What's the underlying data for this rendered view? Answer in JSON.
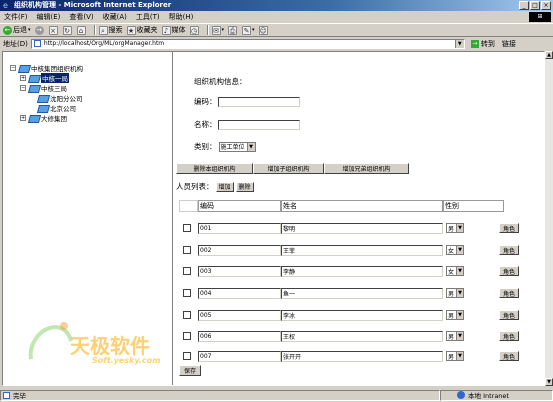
{
  "window": {
    "title": "组织机构管理 - Microsoft Internet Explorer",
    "controls": [
      "_",
      "□",
      "×"
    ]
  },
  "menu": [
    "文件(F)",
    "编辑(E)",
    "查看(V)",
    "收藏(A)",
    "工具(T)",
    "帮助(H)"
  ],
  "toolbar": {
    "back": "后退",
    "search": "搜索",
    "favorites": "收藏夹",
    "media": "媒体"
  },
  "address": {
    "label": "地址(D)",
    "url": "http://localhost/Org/ML/orgManager.htm",
    "go": "转到",
    "links": "链接"
  },
  "tree": {
    "root": "中核集团组织机构",
    "nodes": [
      {
        "label": "中核一局",
        "selected": true
      },
      {
        "label": "中核三局",
        "selected": false
      },
      {
        "label": "沈阳分公司",
        "selected": false
      },
      {
        "label": "北京公司",
        "selected": false
      },
      {
        "label": "大修集团",
        "selected": false
      }
    ]
  },
  "org_info": {
    "title": "组织机构信息：",
    "code_label": "编码：",
    "code_value": "",
    "name_label": "名称：",
    "name_value": "",
    "type_label": "类别：",
    "type_value": "施工单位"
  },
  "actions": {
    "delete_org": "删除本组织机构",
    "add_child": "增加子组织机构",
    "add_sibling": "增加兄弟组织机构"
  },
  "staff": {
    "title": "人员列表：",
    "add": "增加",
    "delete": "删除",
    "columns": [
      "编码",
      "姓名",
      "性别"
    ],
    "role_label": "角色",
    "rows": [
      {
        "code": "001",
        "name": "黎明",
        "gender": "男"
      },
      {
        "code": "002",
        "name": "王菲",
        "gender": "女"
      },
      {
        "code": "003",
        "name": "李静",
        "gender": "女"
      },
      {
        "code": "004",
        "name": "鱼一",
        "gender": "男"
      },
      {
        "code": "005",
        "name": "李冰",
        "gender": "男"
      },
      {
        "code": "006",
        "name": "王权",
        "gender": "男"
      },
      {
        "code": "007",
        "name": "张开开",
        "gender": "男"
      }
    ],
    "save": "保存"
  },
  "watermark": {
    "brand": "天极软件",
    "url": "Soft.yesky.com"
  },
  "status": {
    "text": "完毕",
    "zone": "本地 Intranet"
  }
}
